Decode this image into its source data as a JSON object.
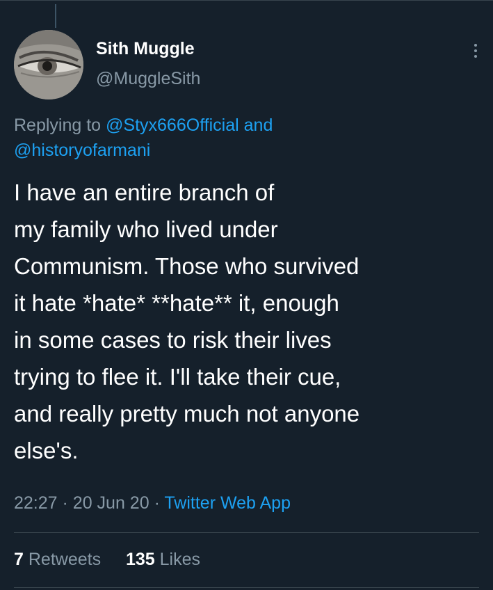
{
  "tweet": {
    "author": {
      "name": "Sith Muggle",
      "handle": "@MuggleSith"
    },
    "reply_context": {
      "prefix": "Replying to",
      "mention_1": "@Styx666Official",
      "conjunction": "and",
      "mention_2": "@historyofarmani"
    },
    "text_lines": [
      "I have an entire branch of",
      "my family who lived under",
      "Communism. Those who survived",
      "it hate *hate* **hate** it, enough",
      "in some cases to risk their lives",
      "trying to flee it. I'll take their cue,",
      "and really pretty much not anyone",
      "else's."
    ],
    "time": "22:27",
    "separator": "·",
    "date": "20 Jun 20",
    "source": "Twitter Web App",
    "retweets": {
      "count": "7",
      "label": "Retweets"
    },
    "likes": {
      "count": "135",
      "label": "Likes"
    }
  },
  "icons": {
    "more": "more-vertical-icon"
  },
  "colors": {
    "background": "#15202b",
    "primary_text": "#ffffff",
    "secondary_text": "#8899a6",
    "link": "#1da1f2",
    "divider": "#38444d"
  }
}
